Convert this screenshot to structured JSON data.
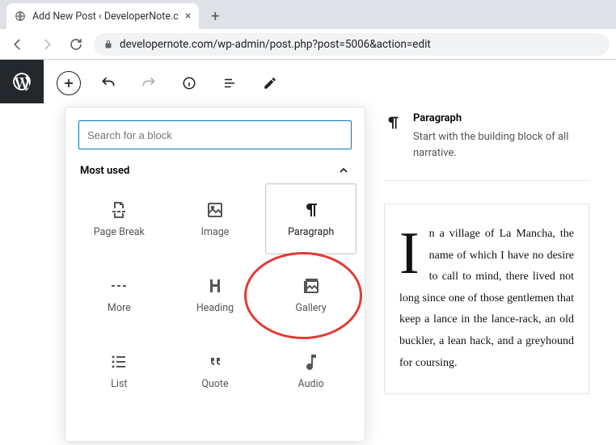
{
  "browser": {
    "tab_title": "Add New Post ‹ DeveloperNote.c",
    "url": "developernote.com/wp-admin/post.php?post=5006&action=edit"
  },
  "inserter": {
    "search_placeholder": "Search for a block",
    "section_label": "Most used",
    "blocks": [
      {
        "name": "page-break",
        "label": "Page Break",
        "icon": "page-break-icon"
      },
      {
        "name": "image",
        "label": "Image",
        "icon": "image-icon"
      },
      {
        "name": "paragraph",
        "label": "Paragraph",
        "icon": "pilcrow-icon",
        "selected": true
      },
      {
        "name": "more",
        "label": "More",
        "icon": "more-icon"
      },
      {
        "name": "heading",
        "label": "Heading",
        "icon": "heading-icon"
      },
      {
        "name": "gallery",
        "label": "Gallery",
        "icon": "gallery-icon"
      },
      {
        "name": "list",
        "label": "List",
        "icon": "list-icon"
      },
      {
        "name": "quote",
        "label": "Quote",
        "icon": "quote-icon"
      },
      {
        "name": "audio",
        "label": "Audio",
        "icon": "audio-icon"
      }
    ]
  },
  "info": {
    "title": "Paragraph",
    "description": "Start with the building block of all narrative."
  },
  "preview": {
    "dropcap": "I",
    "body": "n a village of La Mancha, the name of which I have no desire to call to mind, there lived not long since one of those gentlemen that keep a lance in the lance-rack, an old buckler, a lean hack, and a greyhound for coursing."
  }
}
